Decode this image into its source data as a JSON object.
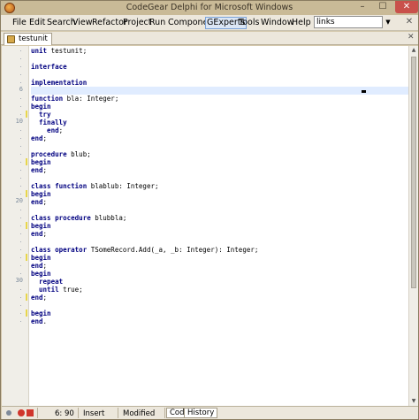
{
  "window": {
    "title": "CodeGear Delphi for Microsoft Windows",
    "min_glyph": "–",
    "max_glyph": "☐",
    "close_glyph": "✕"
  },
  "menu": {
    "items": [
      "File",
      "Edit",
      "Search",
      "View",
      "Refactor",
      "Project",
      "Run",
      "Component",
      "GExperts",
      "Tools",
      "Window",
      "Help"
    ],
    "active_index": 8,
    "search_value": "links",
    "dropdown_glyph": "▼",
    "close_glyph": "✕"
  },
  "tabs": {
    "file_tab": "testunit",
    "close_glyph": "✕"
  },
  "editor": {
    "gutter": [
      {
        "n": "",
        "dot": true,
        "mark": false
      },
      {
        "n": "",
        "dot": true,
        "mark": false
      },
      {
        "n": "",
        "dot": true,
        "mark": false
      },
      {
        "n": "",
        "dot": true,
        "mark": false
      },
      {
        "n": "",
        "dot": true,
        "mark": false
      },
      {
        "n": "6",
        "dot": false,
        "mark": false
      },
      {
        "n": "",
        "dot": true,
        "mark": false
      },
      {
        "n": "",
        "dot": true,
        "mark": false
      },
      {
        "n": "",
        "dot": true,
        "mark": true
      },
      {
        "n": "10",
        "dot": false,
        "mark": false
      },
      {
        "n": "",
        "dot": true,
        "mark": false
      },
      {
        "n": "",
        "dot": true,
        "mark": false
      },
      {
        "n": "",
        "dot": true,
        "mark": false
      },
      {
        "n": "",
        "dot": true,
        "mark": false
      },
      {
        "n": "",
        "dot": true,
        "mark": true
      },
      {
        "n": "",
        "dot": true,
        "mark": false
      },
      {
        "n": "",
        "dot": true,
        "mark": false
      },
      {
        "n": "",
        "dot": true,
        "mark": false
      },
      {
        "n": "",
        "dot": true,
        "mark": true
      },
      {
        "n": "20",
        "dot": false,
        "mark": false
      },
      {
        "n": "",
        "dot": true,
        "mark": false
      },
      {
        "n": "",
        "dot": true,
        "mark": false
      },
      {
        "n": "",
        "dot": true,
        "mark": true
      },
      {
        "n": "",
        "dot": true,
        "mark": false
      },
      {
        "n": "",
        "dot": true,
        "mark": false
      },
      {
        "n": "",
        "dot": true,
        "mark": false
      },
      {
        "n": "",
        "dot": true,
        "mark": true
      },
      {
        "n": "",
        "dot": true,
        "mark": false
      },
      {
        "n": "",
        "dot": true,
        "mark": false
      },
      {
        "n": "30",
        "dot": false,
        "mark": false
      },
      {
        "n": "",
        "dot": true,
        "mark": false
      },
      {
        "n": "",
        "dot": true,
        "mark": true
      },
      {
        "n": "",
        "dot": true,
        "mark": false
      },
      {
        "n": "",
        "dot": true,
        "mark": true
      },
      {
        "n": "",
        "dot": true,
        "mark": false
      }
    ],
    "lines": [
      [
        {
          "t": "unit",
          "k": true
        },
        {
          "t": " testunit;",
          "k": false
        }
      ],
      [],
      [
        {
          "t": "interface",
          "k": true
        }
      ],
      [],
      [
        {
          "t": "implementation",
          "k": true
        }
      ],
      [],
      [
        {
          "t": "function",
          "k": true
        },
        {
          "t": " bla: Integer;",
          "k": false
        }
      ],
      [
        {
          "t": "begin",
          "k": true
        }
      ],
      [
        {
          "t": "  try",
          "k": true
        }
      ],
      [
        {
          "t": "  finally",
          "k": true
        }
      ],
      [
        {
          "t": "    end",
          "k": true
        },
        {
          "t": ";",
          "k": false
        }
      ],
      [
        {
          "t": "end",
          "k": true
        },
        {
          "t": ";",
          "k": false
        }
      ],
      [],
      [
        {
          "t": "procedure",
          "k": true
        },
        {
          "t": " blub;",
          "k": false
        }
      ],
      [
        {
          "t": "begin",
          "k": true
        }
      ],
      [
        {
          "t": "end",
          "k": true
        },
        {
          "t": ";",
          "k": false
        }
      ],
      [],
      [
        {
          "t": "class",
          "k": true
        },
        {
          "t": " ",
          "k": false
        },
        {
          "t": "function",
          "k": true
        },
        {
          "t": " blablub: Integer;",
          "k": false
        }
      ],
      [
        {
          "t": "begin",
          "k": true
        }
      ],
      [
        {
          "t": "end",
          "k": true
        },
        {
          "t": ";",
          "k": false
        }
      ],
      [],
      [
        {
          "t": "class",
          "k": true
        },
        {
          "t": " ",
          "k": false
        },
        {
          "t": "procedure",
          "k": true
        },
        {
          "t": " blubbla;",
          "k": false
        }
      ],
      [
        {
          "t": "begin",
          "k": true
        }
      ],
      [
        {
          "t": "end",
          "k": true
        },
        {
          "t": ";",
          "k": false
        }
      ],
      [],
      [
        {
          "t": "class",
          "k": true
        },
        {
          "t": " ",
          "k": false
        },
        {
          "t": "operator",
          "k": true
        },
        {
          "t": " TSomeRecord.Add(_a, _b: Integer): Integer;",
          "k": false
        }
      ],
      [
        {
          "t": "begin",
          "k": true
        }
      ],
      [
        {
          "t": "end",
          "k": true
        },
        {
          "t": ";",
          "k": false
        }
      ],
      [
        {
          "t": "begin",
          "k": true
        }
      ],
      [
        {
          "t": "  repeat",
          "k": true
        }
      ],
      [
        {
          "t": "  until",
          "k": true
        },
        {
          "t": " true;",
          "k": false
        }
      ],
      [
        {
          "t": "end",
          "k": true
        },
        {
          "t": ";",
          "k": false
        }
      ],
      [],
      [
        {
          "t": "begin",
          "k": true
        }
      ],
      [
        {
          "t": "end",
          "k": true
        },
        {
          "t": ".",
          "k": false
        }
      ]
    ],
    "highlight_line": 5
  },
  "status": {
    "position": "6: 90",
    "insert_mode": "Insert",
    "modified": "Modified",
    "tab_code": "Code",
    "tab_history": "History"
  },
  "colors": {
    "keyword": "#000080",
    "gutter_mark": "#e8d64a",
    "record": "#d0352b"
  }
}
